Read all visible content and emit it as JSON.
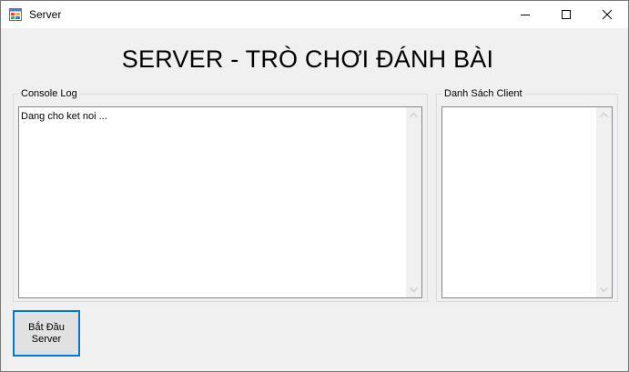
{
  "window": {
    "title": "Server"
  },
  "header": {
    "title": "SERVER - TRÒ CHƠI ĐÁNH BÀI"
  },
  "console_log": {
    "label": "Console Log",
    "content": "Dang cho ket noi ..."
  },
  "client_list": {
    "label": "Danh Sách Client",
    "items": []
  },
  "actions": {
    "start_label": "Bắt Đầu Server"
  },
  "colors": {
    "accent_border": "#0078d7",
    "window_bg": "#f0f0f0",
    "titlebar_bg": "#ffffff"
  },
  "icons": [
    "app-icon",
    "minimize-icon",
    "maximize-icon",
    "close-icon",
    "scroll-up-arrow-icon",
    "scroll-down-arrow-icon"
  ]
}
